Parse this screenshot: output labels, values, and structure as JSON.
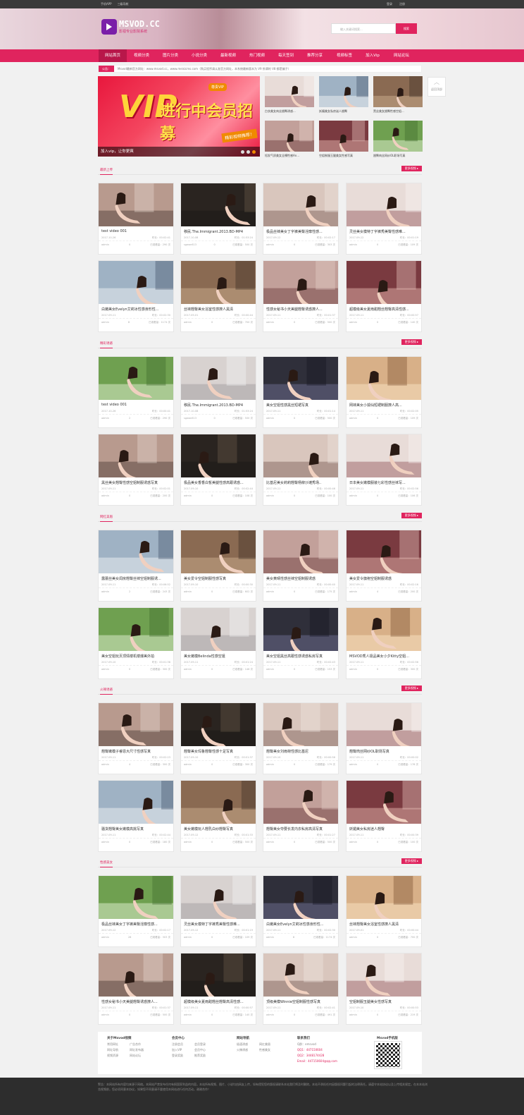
{
  "topbar": {
    "left": [
      "手机APP",
      "三级导航"
    ],
    "right": [
      "登录",
      "注册"
    ]
  },
  "logo": {
    "name": "MSVOD.CC",
    "slogan": "影视专业影院系统"
  },
  "search": {
    "placeholder": "输入关键词搜索...",
    "button": "搜索"
  },
  "nav": [
    "网站首页",
    "视频分类",
    "图片分类",
    "小说分类",
    "最新视频",
    "热门视频",
    "每天签到",
    "推荐分享",
    "视频标签",
    "加入Vip",
    "网站论坛"
  ],
  "notice": {
    "label": "公告：",
    "text": "Msvod最新官方网址：www.msvod.cc，www.meisicms.com（购买程序请认准官方网址，本系统最新版本为 V9 所谓的 V8 都是骗子）"
  },
  "back_top": "返回顶部",
  "banner": {
    "caption": "加入vip，让你更爽",
    "vip_text": "VIP",
    "big_text": "进行中会员招募",
    "tag1": "尊贵VIP",
    "tag2": "精彩视频推荐！"
  },
  "mini_items": [
    {
      "title": "白衣美女肉丝翘臀诱惑..."
    },
    {
      "title": "妖媚美女私房迷人翘臀"
    },
    {
      "title": "黑丝美女翘臀性感空姐..."
    },
    {
      "title": "短发气质美女全裸性感An..."
    },
    {
      "title": "空姐制服玉腿美女性感写真"
    },
    {
      "title": "翘臀肉丝网纱OL职场写真"
    }
  ],
  "sections": [
    {
      "title": "最新上传",
      "more": "更多视频 ▸",
      "items": [
        {
          "title": "test video 001",
          "date": "2017-10-26",
          "dur": "时长：00:02:41",
          "user": "admin",
          "likes": "0",
          "views": "已观看量：290 次"
        },
        {
          "title": "移民.The.Immigrant.2013.BD-MP4",
          "date": "2017-10-08",
          "dur": "时长：01:53:24",
          "user": "sgwan613",
          "likes": "0",
          "views": "已观看量：500 次"
        },
        {
          "title": "极品丝袜美女丁字裤美臀淫靡性感...",
          "date": "2017-09-12",
          "dur": "时长：00:02:17",
          "user": "admin",
          "likes": "0",
          "views": "已观看量：303 次"
        },
        {
          "title": "灵丝美女模特丁字裤秀美臀性感难...",
          "date": "2017-09-12",
          "dur": "时长：00:01:19",
          "user": "admin",
          "likes": "0",
          "views": "已观看量：109 次"
        },
        {
          "title": "白嫩美女Evelyn艾莉冰性感身形性...",
          "date": "2017-09-11",
          "dur": "时长：00:02:30",
          "user": "admin",
          "likes": "8",
          "views": "已观看量：1174 次"
        },
        {
          "title": "丝袜翘臀美女浴室性感撩人黑清",
          "date": "2017-09-01",
          "dur": "时长：00:00:44",
          "user": "admin",
          "likes": "0",
          "views": "已观看量：700 次"
        },
        {
          "title": "性感女秘书小天美腿翘臀诱惑撩人...",
          "date": "2017-09-11",
          "dur": "时长：00:01:37",
          "user": "admin",
          "likes": "0",
          "views": "已观看量：500 次"
        },
        {
          "title": "超模级美女夏雨甜翘丝翘臀高清性感...",
          "date": "2017-09-11",
          "dur": "时长：00:00:57",
          "user": "admin",
          "likes": "0",
          "views": "已观看量：140 次"
        }
      ]
    },
    {
      "title": "精彩诱惑",
      "more": "更多视频 ▸",
      "items": [
        {
          "title": "test video 001",
          "date": "2017-10-26",
          "dur": "时长：00:00:41",
          "user": "admin",
          "likes": "2",
          "views": "已观看量：290 次"
        },
        {
          "title": "移民.The.Immigrant.2013.BD-MP4",
          "date": "2017-10-08",
          "dur": "时长：01:53:24",
          "user": "sgwan613",
          "likes": "0",
          "views": "已观看量：500 次"
        },
        {
          "title": "美女空姐性感黑丝短裙写真",
          "date": "2017-09-11",
          "dur": "时长：00:01:14",
          "user": "admin",
          "likes": "0",
          "views": "已观看量：500 次"
        },
        {
          "title": "网袜美女小狐仙短裙制服撩人高...",
          "date": "2017-09-11",
          "dur": "时长：00:02:05",
          "user": "admin",
          "likes": "0",
          "views": "已观看量：109 次"
        },
        {
          "title": "黑丝美女翘臀性感空姐制服诱惑写真",
          "date": "2017-09-11",
          "dur": "时长：00:02:01",
          "user": "admin",
          "likes": "0",
          "views": "已观看量：200 次"
        },
        {
          "title": "极品美女香香白皙美腿性感高跟诱惑...",
          "date": "2017-09-10",
          "dur": "时长：00:02:44",
          "user": "admin",
          "likes": "0",
          "views": "已观看量：108 次"
        },
        {
          "title": "比基尼美女莉莉翘臀杨柳沙滩秀场..",
          "date": "2017-09-11",
          "dur": "时长：00:00:46",
          "user": "admin",
          "likes": "0",
          "views": "已观看量：100 次"
        },
        {
          "title": "日本美女嫩模服装七彩性感丝袜写...",
          "date": "2017-09-11",
          "dur": "时长：00:02:56",
          "user": "admin",
          "likes": "0",
          "views": "已观看量：106 次"
        }
      ]
    },
    {
      "title": "网红美眉",
      "more": "更多视频 ▸",
      "items": [
        {
          "title": "露蕾丝美女闺房翘臀丝袜空姐制服诱...",
          "date": "2017-09-11",
          "dur": "时长：00:06:52",
          "user": "admin",
          "likes": "2",
          "views": "已观看量：243 次"
        },
        {
          "title": "美女爱令空姐制服性感写真",
          "date": "2017-09-10",
          "dur": "时长：00:00:30",
          "user": "admin",
          "likes": "0",
          "views": "已观看量：602 次"
        },
        {
          "title": "美女黄晴性感丝袜空姐制服诱惑",
          "date": "2017-09-11",
          "dur": "时长：00:00:40",
          "user": "admin",
          "likes": "0",
          "views": "已观看量：175 次"
        },
        {
          "title": "美女爱令旗袍空姐制服诱惑",
          "date": "2017-09-11",
          "dur": "时长：00:02:16",
          "user": "admin",
          "likes": "4",
          "views": "已观看量：200 次"
        },
        {
          "title": "美女空姐玩页顶情楼机楼爆美外拍",
          "date": "2017-09-10",
          "dur": "时长：00:01:38",
          "user": "admin",
          "likes": "0",
          "views": "已观看量：300 次"
        },
        {
          "title": "美女嫩模Belinda性感空姐",
          "date": "2017-09-11",
          "dur": "时长：00:01:24",
          "user": "admin",
          "likes": "0",
          "views": "已观看量：146 次"
        },
        {
          "title": "美女空姐黑丝高跟性感诱惑私房写真",
          "date": "2017-09-11",
          "dur": "时长：00:02:43",
          "user": "admin",
          "likes": "0",
          "views": "已观看量：153 次"
        },
        {
          "title": "MSVOD秀人极品美女小夕Kitty空姐...",
          "date": "2017-09-11",
          "dur": "时长：00:02:56",
          "user": "admin",
          "likes": "0",
          "views": "已观看量：300 次"
        }
      ]
    },
    {
      "title": "火辣诱惑",
      "more": "更多视频 ▸",
      "items": [
        {
          "title": "翘臀嫩模子睿恩大尺寸性感写真",
          "date": "2017-09-11",
          "dur": "时长：00:02:23",
          "user": "admin",
          "likes": "4",
          "views": "已观看量：300 次"
        },
        {
          "title": "翘臀美女玛鲁翘臀性感十足写真",
          "date": "2017-09-10",
          "dur": "时长：00:01:37",
          "user": "admin",
          "likes": "0",
          "views": "已观看量：300 次"
        },
        {
          "title": "翘臀美女刘雨荷性感比基尼",
          "date": "2017-09-10",
          "dur": "时长：00:00:56",
          "user": "admin",
          "likes": "0",
          "views": "已观看量：179 次"
        },
        {
          "title": "翘臀肉丝网纱OL职场写真",
          "date": "2017-09-11",
          "dur": "时长：00:00:02",
          "user": "admin",
          "likes": "0",
          "views": "已观看量：178 次"
        },
        {
          "title": "骚货翘臀美女嫩模高挑写真",
          "date": "2017-09-11",
          "dur": "时长：00:02:44",
          "user": "admin",
          "likes": "0",
          "views": "已观看量：180 次"
        },
        {
          "title": "美女嫩模玩人翘乳白纱翘臀写真",
          "date": "2017-09-12",
          "dur": "时长：00:01:33",
          "user": "admin",
          "likes": "0",
          "views": "已观看量：500 次"
        },
        {
          "title": "翘臀美女夺要长发内衣私房高清写真",
          "date": "2017-09-11",
          "dur": "时长：00:01:27",
          "user": "admin",
          "likes": "0",
          "views": "已观看量：500 次"
        },
        {
          "title": "妖媚美女私房迷人翘臀",
          "date": "2017-09-11",
          "dur": "时长：00:00:39",
          "user": "admin",
          "likes": "0",
          "views": "已观看量：100 次"
        }
      ]
    },
    {
      "title": "性感美女",
      "more": "更多视频 ▸",
      "items": [
        {
          "title": "极品丝袜美女丁字裤美臀淫靡性感...",
          "date": "2017-09-12",
          "dur": "时长：00:02:17",
          "user": "admin",
          "likes": "28",
          "views": "已观看量：303 次"
        },
        {
          "title": "灵丝美女模特丁字裤秀美臀性感难...",
          "date": "2017-09-12",
          "dur": "时长：00:01:19",
          "user": "admin",
          "likes": "0",
          "views": "已观看量：109 次"
        },
        {
          "title": "白嫩美女Evelyn艾莉冰性感身形性...",
          "date": "2017-09-11",
          "dur": "时长：00:02:30",
          "user": "admin",
          "likes": "8",
          "views": "已观看量：1174 次"
        },
        {
          "title": "丝袜翘臀美女浴室性感撩人黑清",
          "date": "2017-09-01",
          "dur": "时长：00:00:44",
          "user": "admin",
          "likes": "0",
          "views": "已观看量：700 次"
        },
        {
          "title": "性感女秘书小天美腿翘臀诱惑撩人...",
          "date": "2017-09-11",
          "dur": "时长：00:01:37",
          "user": "admin",
          "likes": "0",
          "views": "已观看量：500 次"
        },
        {
          "title": "超模级美女夏雨甜翘丝翘臀高清性感...",
          "date": "2017-09-11",
          "dur": "时长：00:00:57",
          "user": "admin",
          "likes": "0",
          "views": "已观看量：140 次"
        },
        {
          "title": "顶级美模Winnie空姐制服性感写真",
          "date": "2017-09-11",
          "dur": "时长：00:02:41",
          "user": "admin",
          "likes": "0",
          "views": "已观看量：491 次"
        },
        {
          "title": "空姐制服玉腿美女性感写真",
          "date": "2017-09-10",
          "dur": "时长：00:00:53",
          "user": "admin",
          "likes": "0",
          "views": "已观看量：219 次"
        }
      ]
    }
  ],
  "footer": {
    "col1": {
      "title": "关于Msvod视频",
      "links": [
        "常用网址",
        "广告合作",
        "网址导航",
        "网址发布器",
        "视频资源",
        "网站论坛"
      ]
    },
    "col2": {
      "title": "会员中心",
      "links": [
        "注册会员",
        "会员登录",
        "加入VIP",
        "会员中心",
        "登录奖励",
        "推荐奖励"
      ]
    },
    "col3": {
      "title": "网站导航",
      "links": [
        "极速诱惑",
        "网红美眉",
        "火辣诱惑",
        "性感美女"
      ]
    },
    "col4": {
      "title": "联系我们",
      "lines": [
        "Q群：emsvod",
        "QQ1：447150604",
        "QQ2：3448174428",
        "Email：447150604@qq.com"
      ]
    },
    "col5": {
      "title": "Msvod手机版"
    }
  },
  "bottom": {
    "text": "警告：本网站所有内容均来源于网络。本网站严禁发布任何有损国家利益的内容。本站所有视频、图片、小说均由网友上传，如有侵犯您的版权请联系本站我们将及时删除。本站不承担任何因版权问题引起的法律责任。请遵守本站协议以及上传相关规定。在本本站浏览视频前，您必须同意本协议，如果您不同意请不要使用本网站进行任何活动，谢谢合作！"
  },
  "colors": {
    "accent": "#e0245e",
    "dark": "#2d2d2d"
  }
}
